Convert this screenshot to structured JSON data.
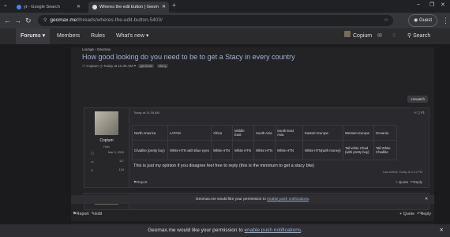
{
  "browser": {
    "tabs": [
      {
        "title": "yt - Google Search",
        "active": false
      },
      {
        "title": "Wheres the edit button | Geom",
        "active": true
      }
    ],
    "new_tab": "+",
    "address": {
      "domain": "geomax.me",
      "path": "/threads/wheres-the-edit-button.5403/"
    },
    "profile": "Guest"
  },
  "site_nav": {
    "items": [
      "Forums",
      "Members",
      "Rules",
      "What's new"
    ],
    "user": "Copium",
    "search": "Search"
  },
  "thread": {
    "breadcrumb": [
      "Lounge",
      "Geomax"
    ],
    "title": "How good looking do you need to be to get a Stacy in every country",
    "meta": {
      "author": "Copium",
      "date": "Today at 11:35 AM",
      "tags": [
        "geomax",
        "stacy"
      ]
    },
    "unwatch": "Unwatch"
  },
  "post1": {
    "date": "Today at 11:35 AM",
    "number": "#1",
    "user": {
      "name": "Copium",
      "title": "Halo",
      "joined": "Mar 3, 2024",
      "messages": "117",
      "reactions": "124"
    },
    "table": {
      "headers": [
        "North America",
        "LATAM",
        "Africa",
        "Middle East",
        "South Asia",
        "South East Asia",
        "Eastern Europe",
        "Western Europe",
        "Oceania"
      ],
      "row": [
        "Chadlite (pretty boy)",
        "White HTN with Blue eyes",
        "White HTN",
        "White HTN",
        "White HTN",
        "White HTN",
        "White HTN(with money)",
        "Tall white Chad (with pretty boy)",
        "Tall White Chadlite"
      ]
    },
    "text": "This is just my opinion if you disagree feel free to reply (this is the minimum to get a stacy btw)",
    "last_edited": "Last edited: Today at 1:01 PM",
    "report": "Report",
    "quote": "+ Quote",
    "reply": "Reply"
  },
  "post2": {
    "date": "Today at 12:31 PM",
    "number": "#2"
  },
  "notif_inline": {
    "pre": "Geomax.me would like your permission to ",
    "link": "enable push notifications",
    "post": "."
  },
  "bottom_actions": {
    "report": "Report",
    "edit": "Edit",
    "quote": "+ Quote",
    "reply": "Reply"
  },
  "notif_bar": {
    "pre": "Geomax.me would like your permission to ",
    "link": "enable push notifications",
    "post": "."
  }
}
